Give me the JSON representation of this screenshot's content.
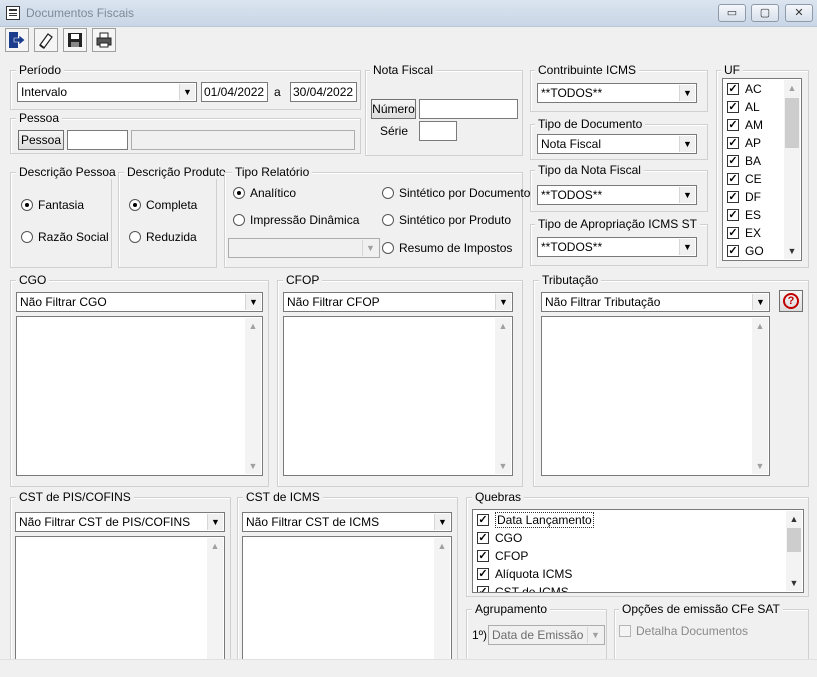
{
  "window": {
    "title": "Documentos Fiscais",
    "minimize": "▭",
    "maximize": "▢",
    "close": "✕"
  },
  "toolbar": {
    "icons": [
      "exit-icon",
      "eraser-icon",
      "save-icon",
      "print-icon"
    ]
  },
  "periodo": {
    "legend": "Período",
    "combo": "Intervalo",
    "date_from": "01/04/2022",
    "sep": "a",
    "date_to": "30/04/2022"
  },
  "pessoa": {
    "legend": "Pessoa",
    "button": "Pessoa",
    "code": "",
    "name": ""
  },
  "nota_fiscal": {
    "legend": "Nota Fiscal",
    "numero_button": "Número",
    "numero": "",
    "serie_label": "Série",
    "serie": ""
  },
  "contribuinte": {
    "legend": "Contribuinte ICMS",
    "value": "**TODOS**"
  },
  "tipo_documento": {
    "legend": "Tipo de Documento",
    "value": "Nota Fiscal"
  },
  "tipo_nota": {
    "legend": "Tipo da Nota Fiscal",
    "value": "**TODOS**"
  },
  "tipo_apropriacao": {
    "legend": "Tipo de Apropriação ICMS ST",
    "value": "**TODOS**"
  },
  "uf": {
    "legend": "UF",
    "items": [
      "AC",
      "AL",
      "AM",
      "AP",
      "BA",
      "CE",
      "DF",
      "ES",
      "EX",
      "GO"
    ]
  },
  "descricao_pessoa": {
    "legend": "Descrição Pessoa",
    "options": [
      "Fantasia",
      "Razão Social"
    ],
    "selected": 0
  },
  "descricao_produto": {
    "legend": "Descrição Produto",
    "options": [
      "Completa",
      "Reduzida"
    ],
    "selected": 0
  },
  "tipo_relatorio": {
    "legend": "Tipo Relatório",
    "analitico": "Analítico",
    "impressao": "Impressão Dinâmica",
    "sint_doc": "Sintético por Documento",
    "sint_prod": "Sintético por Produto",
    "resumo": "Resumo de Impostos",
    "combo": ""
  },
  "cgo": {
    "legend": "CGO",
    "combo": "Não Filtrar CGO"
  },
  "cfop": {
    "legend": "CFOP",
    "combo": "Não Filtrar CFOP"
  },
  "tributacao": {
    "legend": "Tributação",
    "combo": "Não Filtrar Tributação",
    "help": "?"
  },
  "cst_pis": {
    "legend": "CST de PIS/COFINS",
    "combo": "Não Filtrar CST de PIS/COFINS"
  },
  "cst_icms": {
    "legend": "CST de ICMS",
    "combo": "Não Filtrar CST de ICMS"
  },
  "quebras": {
    "legend": "Quebras",
    "items": [
      "Data Lançamento",
      "CGO",
      "CFOP",
      "Alíquota ICMS",
      "CST de ICMS"
    ]
  },
  "agrupamento": {
    "legend": "Agrupamento",
    "label": "1º)",
    "combo": "Data de Emissão"
  },
  "cfe_sat": {
    "legend": "Opções de emissão CFe SAT",
    "detalha": "Detalha Documentos"
  }
}
